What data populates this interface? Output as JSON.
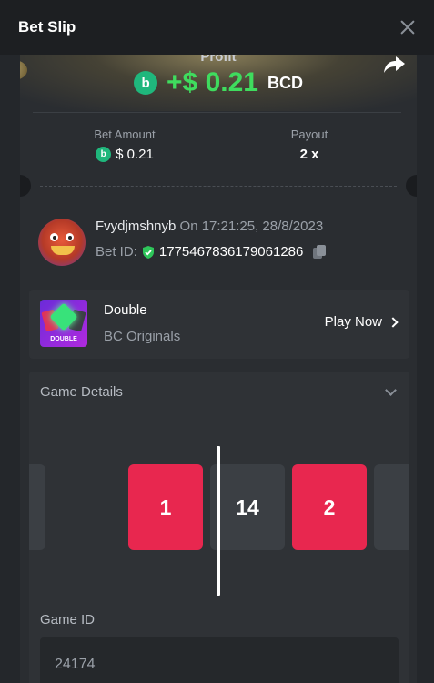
{
  "header": {
    "title": "Bet Slip"
  },
  "profit": {
    "label": "Profit",
    "value": "+$ 0.21",
    "currency": "BCD",
    "coin_symbol": "b"
  },
  "bet_amount": {
    "label": "Bet Amount",
    "value": "$ 0.21"
  },
  "payout": {
    "label": "Payout",
    "value": "2 x"
  },
  "user": {
    "name": "Fvydjmshnyb",
    "on_text": "On 17:21:25, 28/8/2023",
    "bet_id_label": "Bet ID:",
    "bet_id": "177546783617906128​6"
  },
  "game": {
    "name": "Double",
    "provider": "BC Originals",
    "thumb_text": "DOUBLE",
    "play_label": "Play Now"
  },
  "details": {
    "title": "Game Details",
    "tiles": [
      "1",
      "14",
      "2"
    ],
    "game_id_label": "Game ID",
    "game_id_value": "24174"
  },
  "colors": {
    "accent_green": "#3fdc5e",
    "coin": "#1fb77c",
    "red_tile": "#e8274f",
    "dark_tile": "#3b3f44"
  },
  "icons": [
    "close-icon",
    "share-icon",
    "coin-icon",
    "shield-check-icon",
    "copy-icon",
    "chevron-right-icon",
    "chevron-down-icon"
  ]
}
